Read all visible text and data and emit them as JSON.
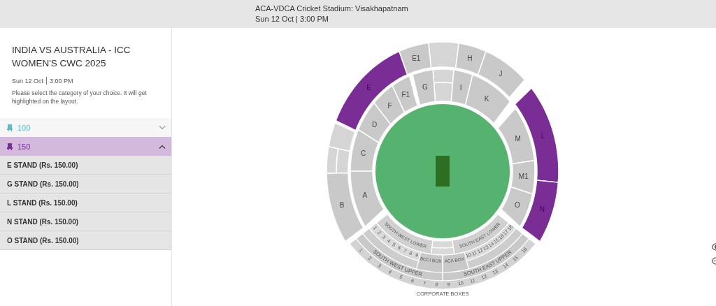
{
  "header": {
    "venue": "ACA-VDCA Cricket Stadium: Visakhapatnam",
    "datetime": "Sun 12 Oct | 3:00 PM"
  },
  "event": {
    "title": "INDIA VS AUSTRALIA - ICC WOMEN'S CWC 2025",
    "date": "Sun 12 Oct",
    "time": "3:00 PM",
    "instructions": "Please select the category of your choice. It will get highlighted on the layout."
  },
  "categories": [
    {
      "label": "100",
      "color": "#5bbccb",
      "expanded": false,
      "selected": false
    },
    {
      "label": "150",
      "color": "#7b2d96",
      "expanded": true,
      "selected": true,
      "stands": [
        "E STAND (Rs. 150.00)",
        "G STAND (Rs. 150.00)",
        "L STAND (Rs. 150.00)",
        "N STAND (Rs. 150.00)",
        "O STAND (Rs. 150.00)"
      ]
    }
  ],
  "map": {
    "sections": [
      {
        "label": "E1",
        "highlighted": false
      },
      {
        "label": "H",
        "highlighted": false
      },
      {
        "label": "J",
        "highlighted": false
      },
      {
        "label": "E",
        "highlighted": true
      },
      {
        "label": "G",
        "highlighted": false
      },
      {
        "label": "F1",
        "highlighted": false
      },
      {
        "label": "I",
        "highlighted": false
      },
      {
        "label": "F",
        "highlighted": false
      },
      {
        "label": "K",
        "highlighted": false
      },
      {
        "label": "D",
        "highlighted": false
      },
      {
        "label": "M",
        "highlighted": false
      },
      {
        "label": "L",
        "highlighted": true
      },
      {
        "label": "C",
        "highlighted": false
      },
      {
        "label": "M1",
        "highlighted": false
      },
      {
        "label": "B",
        "highlighted": false
      },
      {
        "label": "A",
        "highlighted": false
      },
      {
        "label": "O",
        "highlighted": false
      },
      {
        "label": "N",
        "highlighted": true
      }
    ],
    "lower": [
      "SOUTH WEST LOWER",
      "SOUTH EAST LOWER"
    ],
    "west_boxes": [
      "1",
      "2",
      "3",
      "4",
      "5",
      "6",
      "7",
      "8",
      "9"
    ],
    "center_boxes": [
      "BCCI BOX",
      "ACA BOX"
    ],
    "east_boxes": [
      "10",
      "11",
      "12",
      "13",
      "14",
      "15",
      "16",
      "17",
      "18"
    ],
    "upper": [
      "SOUTH WEST UPPER",
      "SOUTH EAST UPPER"
    ],
    "corporate_boxes": [
      "1",
      "2",
      "3",
      "4",
      "5",
      "6",
      "7",
      "8",
      "9",
      "10",
      "11",
      "12",
      "13",
      "14",
      "15",
      "16"
    ],
    "caption": "CORPORATE BOXES"
  }
}
